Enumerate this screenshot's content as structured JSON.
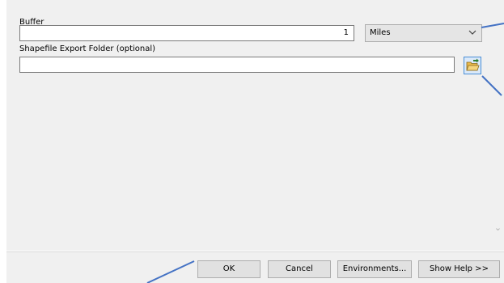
{
  "buffer": {
    "label": "Buffer",
    "value": "1",
    "unit": "Miles"
  },
  "shapefile_folder": {
    "label": "Shapefile Export Folder (optional)",
    "value": ""
  },
  "icons": {
    "browse": "folder-browse-icon",
    "dropdown": "chevron-down-icon"
  },
  "buttons": {
    "ok": "OK",
    "cancel": "Cancel",
    "environments": "Environments...",
    "show_help": "Show Help >>"
  },
  "colors": {
    "callout_line": "#4472c4",
    "panel_bg": "#f0f0f0"
  }
}
